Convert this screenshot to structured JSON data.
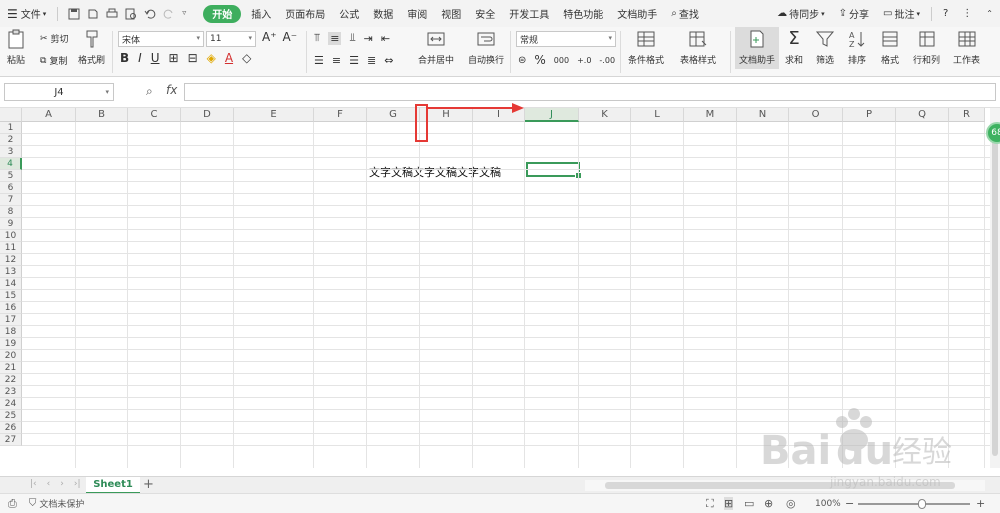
{
  "menubar": {
    "file_label": "文件",
    "tabs": [
      "开始",
      "插入",
      "页面布局",
      "公式",
      "数据",
      "审阅",
      "视图",
      "安全",
      "开发工具",
      "特色功能",
      "文档助手"
    ],
    "active_tab": "开始",
    "search_label": "查找",
    "sync_label": "待同步",
    "share_label": "分享",
    "comment_label": "批注"
  },
  "ribbon": {
    "paste": "粘贴",
    "cut": "剪切",
    "copy": "复制",
    "format_painter": "格式刷",
    "font_name": "宋体",
    "font_size": "11",
    "merge_center": "合并居中",
    "wrap_text": "自动换行",
    "number_format": "常规",
    "conditional_format": "条件格式",
    "table_style": "表格样式",
    "doc_assistant": "文档助手",
    "sum": "求和",
    "filter": "筛选",
    "sort": "排序",
    "format": "格式",
    "rows_cols": "行和列",
    "worksheet": "工作表"
  },
  "formula_bar": {
    "name_box": "J4",
    "fx_label": "fx",
    "formula_value": ""
  },
  "grid": {
    "columns": [
      "A",
      "B",
      "C",
      "D",
      "E",
      "F",
      "G",
      "H",
      "I",
      "J",
      "K",
      "L",
      "M",
      "N",
      "O",
      "P",
      "Q",
      "R"
    ],
    "rows": [
      "1",
      "2",
      "3",
      "4",
      "5",
      "6",
      "7",
      "8",
      "9",
      "10",
      "11",
      "12",
      "13",
      "14",
      "15",
      "16",
      "17",
      "18",
      "19",
      "20",
      "21",
      "22",
      "23",
      "24",
      "25",
      "26",
      "27"
    ],
    "selected_column": "J",
    "selected_row": "4",
    "cell_G4": "文字文稿文字文稿文字文稿",
    "side_badge": "68"
  },
  "sheets": {
    "tabs": [
      "Sheet1"
    ],
    "active": "Sheet1"
  },
  "status": {
    "protection": "文档未保护",
    "zoom": "100%"
  },
  "watermark": {
    "brand": "Baidu经验",
    "url": "jingyan.baidu.com"
  },
  "colors": {
    "accent_green": "#3a9a5a",
    "annotation_red": "#e53935"
  }
}
